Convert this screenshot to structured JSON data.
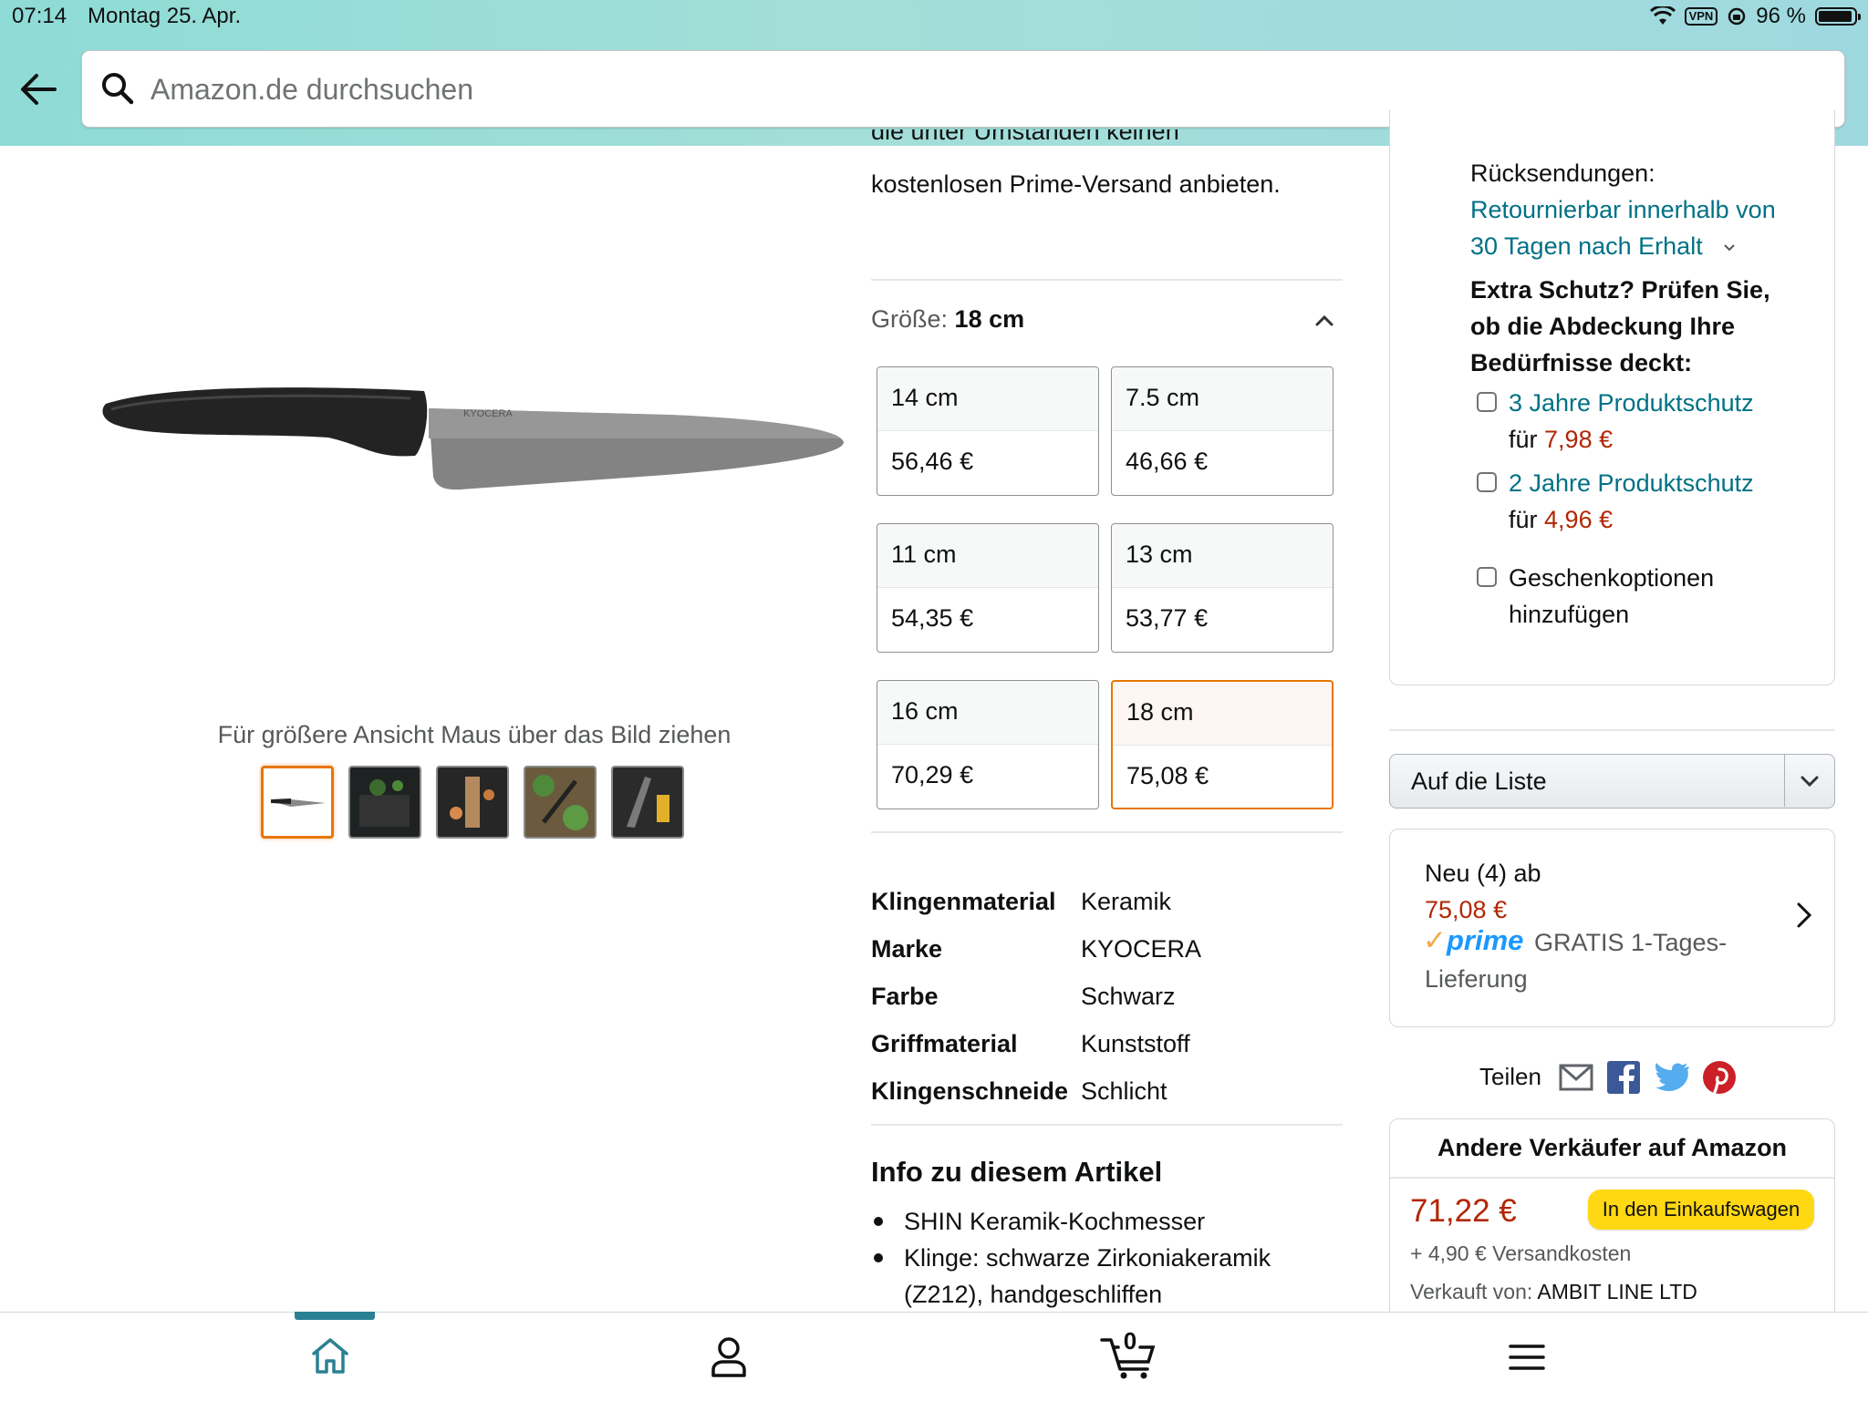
{
  "status_bar": {
    "time": "07:14",
    "date": "Montag 25. Apr.",
    "vpn": "VPN",
    "battery": "96 %"
  },
  "search": {
    "placeholder": "Amazon.de durchsuchen"
  },
  "gallery": {
    "zoom_hint": "Für größere Ansicht Maus über das Bild ziehen",
    "image_logo_text": "KYOCERA",
    "thumbnails": [
      "knife-white-bg",
      "knife-on-board",
      "knife-with-food",
      "knife-with-herbs",
      "knife-dark"
    ]
  },
  "shipping_note": {
    "line1": "die unter Umständen keinen",
    "line2": "kostenlosen Prime-Versand anbieten."
  },
  "size": {
    "label": "Größe:",
    "selected": "18 cm",
    "options": [
      {
        "size": "14 cm",
        "price": "56,46 €"
      },
      {
        "size": "7.5 cm",
        "price": "46,66 €"
      },
      {
        "size": "11 cm",
        "price": "54,35 €"
      },
      {
        "size": "13 cm",
        "price": "53,77 €"
      },
      {
        "size": "16 cm",
        "price": "70,29 €"
      },
      {
        "size": "18 cm",
        "price": "75,08 €"
      }
    ]
  },
  "specs": [
    {
      "label": "Klingenmaterial",
      "value": "Keramik"
    },
    {
      "label": "Marke",
      "value": "KYOCERA"
    },
    {
      "label": "Farbe",
      "value": "Schwarz"
    },
    {
      "label": "Griffmaterial",
      "value": "Kunststoff"
    },
    {
      "label": "Klingenschneide",
      "value": "Schlicht"
    }
  ],
  "info": {
    "title": "Info zu diesem Artikel",
    "bullets": [
      {
        "line1": "SHIN Keramik-Kochmesser",
        "line2": ""
      },
      {
        "line1": "Klinge: schwarze Zirkoniakeramik",
        "line2": "(Z212), handgeschliffen"
      }
    ]
  },
  "returns": {
    "label": "Rücksendungen:",
    "link_line1": "Retournierbar innerhalb von",
    "link_line2": "30 Tagen nach Erhalt"
  },
  "protection": {
    "heading_line1": "Extra Schutz? Prüfen Sie,",
    "heading_line2": "ob die Abdeckung Ihre",
    "heading_line3": "Bedürfnisse deckt:",
    "plan1": {
      "name": "3 Jahre Produktschutz",
      "for": "für",
      "price": "7,98 €"
    },
    "plan2": {
      "name": "2 Jahre Produktschutz",
      "for": "für",
      "price": "4,96 €"
    },
    "gift_line1": "Geschenkoptionen",
    "gift_line2": "hinzufügen"
  },
  "list_dropdown": {
    "label": "Auf die Liste"
  },
  "new_offers": {
    "label": "Neu (4) ab",
    "price": "75,08 €",
    "prime": "prime",
    "delivery_line1": "GRATIS 1-Tages-",
    "delivery_line2": "Lieferung"
  },
  "share": {
    "label": "Teilen"
  },
  "other_sellers": {
    "title": "Andere Verkäufer auf Amazon",
    "price": "71,22 €",
    "button": "In den Einkaufswagen",
    "shipping": "+ 4,90 € Versandkosten",
    "sold_by_label": "Verkauft von:",
    "sold_by": "AMBIT LINE LTD"
  },
  "bottom_nav": {
    "cart_count": "0"
  },
  "colors": {
    "accent_orange": "#e77600",
    "link": "#007185",
    "price_red": "#b12704",
    "cart_button": "#ffd814",
    "nav_indicator": "#2a8193"
  }
}
